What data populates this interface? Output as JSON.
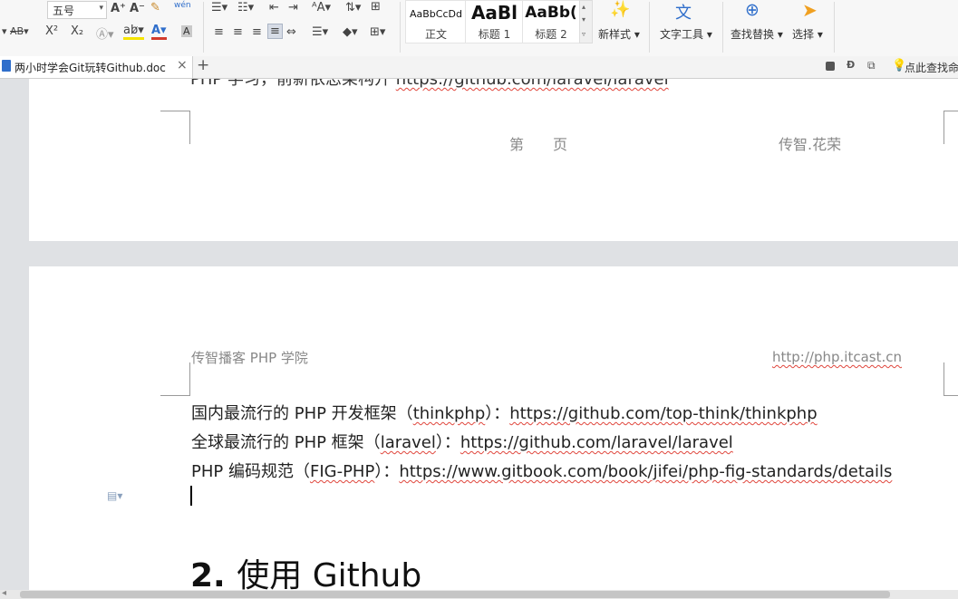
{
  "ribbon": {
    "font_size": "五号",
    "grow_font": "A⁺",
    "shrink_font": "A⁻",
    "clear_format": "✎",
    "phonetic": "wén",
    "strike_label": "AB",
    "superscript": "X²",
    "subscript": "X₂",
    "styles": [
      {
        "preview": "AaBbCcDd",
        "name": "正文"
      },
      {
        "preview": "AaBl",
        "name": "标题 1"
      },
      {
        "preview": "AaBb(",
        "name": "标题 2"
      }
    ],
    "new_style": "新样式",
    "text_tools": "文字工具",
    "find_replace": "查找替换",
    "select": "选择"
  },
  "tabs": {
    "doc_title": "两小时学会Git玩转Github.doc",
    "close": "×",
    "add": "+",
    "search_hint": "点此查找命"
  },
  "page1": {
    "cut_line_prefix": "PHP 学习，前新依恋架构开",
    "cut_line_link": "https://github.com/laravel/laravel",
    "footer_page": "第　　页",
    "footer_author": "传智.花荣"
  },
  "page2": {
    "header_left": "传智播客 PHP 学院",
    "header_right": "http://php.itcast.cn",
    "lines": [
      {
        "prefix": "国内最流行的 PHP 开发框架（",
        "name": "thinkphp",
        "mid": "）：",
        "link": "https://github.com/top-think/thinkphp"
      },
      {
        "prefix": "全球最流行的 PHP 框架（",
        "name": "laravel",
        "mid": "）：",
        "link": "https://github.com/laravel/laravel"
      },
      {
        "prefix": "PHP 编码规范（",
        "name": "FIG-PHP",
        "mid": "）：",
        "link": "https://www.gitbook.com/book/jifei/php-fig-standards/details"
      }
    ],
    "heading_num": "2.",
    "heading_text": "使用 Github"
  },
  "colors": {
    "accent": "#2f6ecb",
    "squiggle": "#e0463c",
    "page": "#ffffff",
    "canvas": "#dfe1e4"
  }
}
